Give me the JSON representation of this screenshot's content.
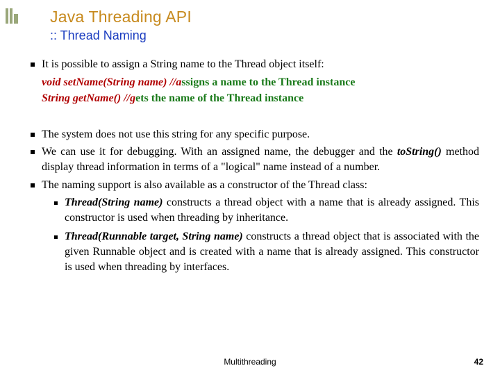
{
  "header": {
    "title": "Java Threading API",
    "subtitle": ":: Thread Naming"
  },
  "body": {
    "b1": "It is possible to assign a String name to the Thread object itself:",
    "sig1_code": "void setName(String name) //a",
    "sig1_comment": "ssigns a name to the Thread instance",
    "sig2_code": "String getName() //g",
    "sig2_comment": "ets the name of the Thread instance",
    "b2": "The system does not use this string for any specific purpose.",
    "b3_pre": "We can use it for debugging. With an assigned name, the debugger and the ",
    "b3_em": "toString()",
    "b3_post": " method display thread information in terms of a \"logical\" name instead of a number.",
    "b4": "The naming support is also available as a constructor of the Thread class:",
    "s1_em": "Thread(String name)",
    "s1_txt": " constructs a thread object with a name that is already assigned. This constructor is used when threading by inheritance.",
    "s2_em": "Thread(Runnable target, String name)",
    "s2_txt": " constructs a thread object that is associated with the given Runnable object and is created with a name that is already assigned. This constructor is used when threading by interfaces."
  },
  "footer": {
    "label": "Multithreading",
    "page": "42"
  }
}
